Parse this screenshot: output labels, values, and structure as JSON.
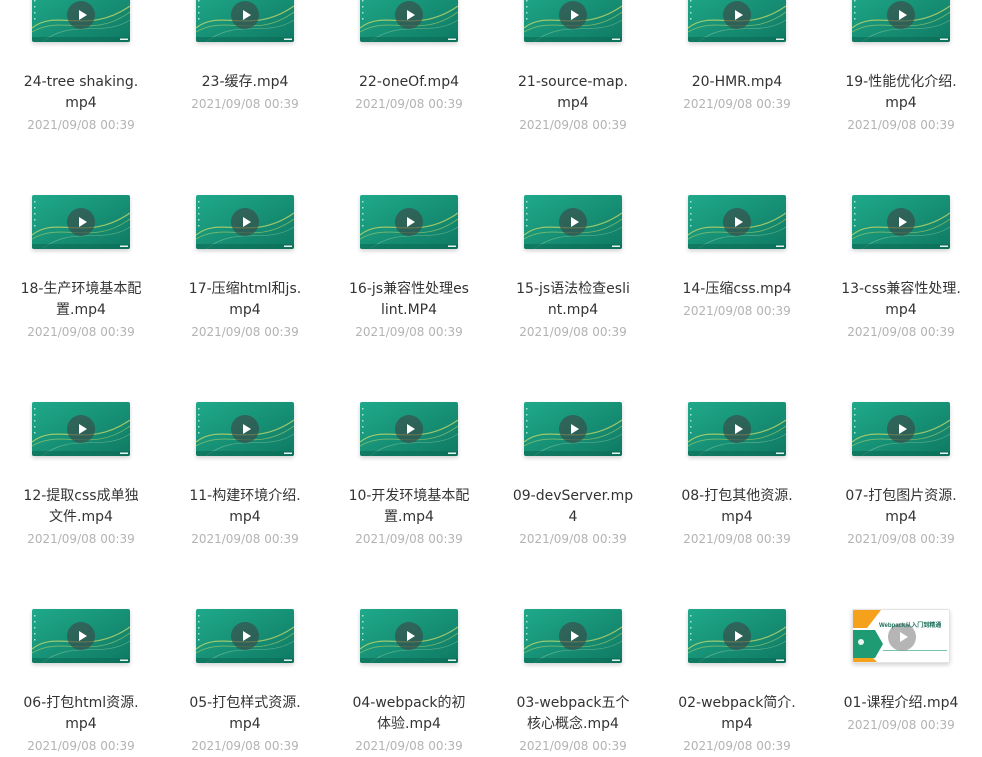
{
  "files": [
    {
      "name": "24-tree shaking.mp4",
      "date": "2021/09/08 00:39",
      "thumb": "video"
    },
    {
      "name": "23-缓存.mp4",
      "date": "2021/09/08 00:39",
      "thumb": "video"
    },
    {
      "name": "22-oneOf.mp4",
      "date": "2021/09/08 00:39",
      "thumb": "video"
    },
    {
      "name": "21-source-map.mp4",
      "date": "2021/09/08 00:39",
      "thumb": "video"
    },
    {
      "name": "20-HMR.mp4",
      "date": "2021/09/08 00:39",
      "thumb": "video"
    },
    {
      "name": "19-性能优化介绍.mp4",
      "date": "2021/09/08 00:39",
      "thumb": "video"
    },
    {
      "name": "18-生产环境基本配置.mp4",
      "date": "2021/09/08 00:39",
      "thumb": "video"
    },
    {
      "name": "17-压缩html和js.mp4",
      "date": "2021/09/08 00:39",
      "thumb": "video"
    },
    {
      "name": "16-js兼容性处理eslint.MP4",
      "date": "2021/09/08 00:39",
      "thumb": "video"
    },
    {
      "name": "15-js语法检查eslint.mp4",
      "date": "2021/09/08 00:39",
      "thumb": "video"
    },
    {
      "name": "14-压缩css.mp4",
      "date": "2021/09/08 00:39",
      "thumb": "video"
    },
    {
      "name": "13-css兼容性处理.mp4",
      "date": "2021/09/08 00:39",
      "thumb": "video"
    },
    {
      "name": "12-提取css成单独文件.mp4",
      "date": "2021/09/08 00:39",
      "thumb": "video"
    },
    {
      "name": "11-构建环境介绍.mp4",
      "date": "2021/09/08 00:39",
      "thumb": "video"
    },
    {
      "name": "10-开发环境基本配置.mp4",
      "date": "2021/09/08 00:39",
      "thumb": "video"
    },
    {
      "name": "09-devServer.mp4",
      "date": "2021/09/08 00:39",
      "thumb": "video"
    },
    {
      "name": "08-打包其他资源.mp4",
      "date": "2021/09/08 00:39",
      "thumb": "video"
    },
    {
      "name": "07-打包图片资源.mp4",
      "date": "2021/09/08 00:39",
      "thumb": "video"
    },
    {
      "name": "06-打包html资源.mp4",
      "date": "2021/09/08 00:39",
      "thumb": "video"
    },
    {
      "name": "05-打包样式资源.mp4",
      "date": "2021/09/08 00:39",
      "thumb": "video"
    },
    {
      "name": "04-webpack的初体验.mp4",
      "date": "2021/09/08 00:39",
      "thumb": "video"
    },
    {
      "name": "03-webpack五个核心概念.mp4",
      "date": "2021/09/08 00:39",
      "thumb": "video"
    },
    {
      "name": "02-webpack简介.mp4",
      "date": "2021/09/08 00:39",
      "thumb": "video"
    },
    {
      "name": "01-课程介绍.mp4",
      "date": "2021/09/08 00:39",
      "thumb": "intro",
      "thumb_caption": "Webpack从入门到精通"
    }
  ],
  "colors": {
    "thumb_teal_dark": "#0f7a63",
    "thumb_teal_light": "#1fa98a",
    "thumb_wave": "#c9d86a",
    "intro_orange": "#f5a11c",
    "intro_green": "#1e9b73",
    "name_text": "#333333",
    "date_text": "#b3b3b3"
  }
}
